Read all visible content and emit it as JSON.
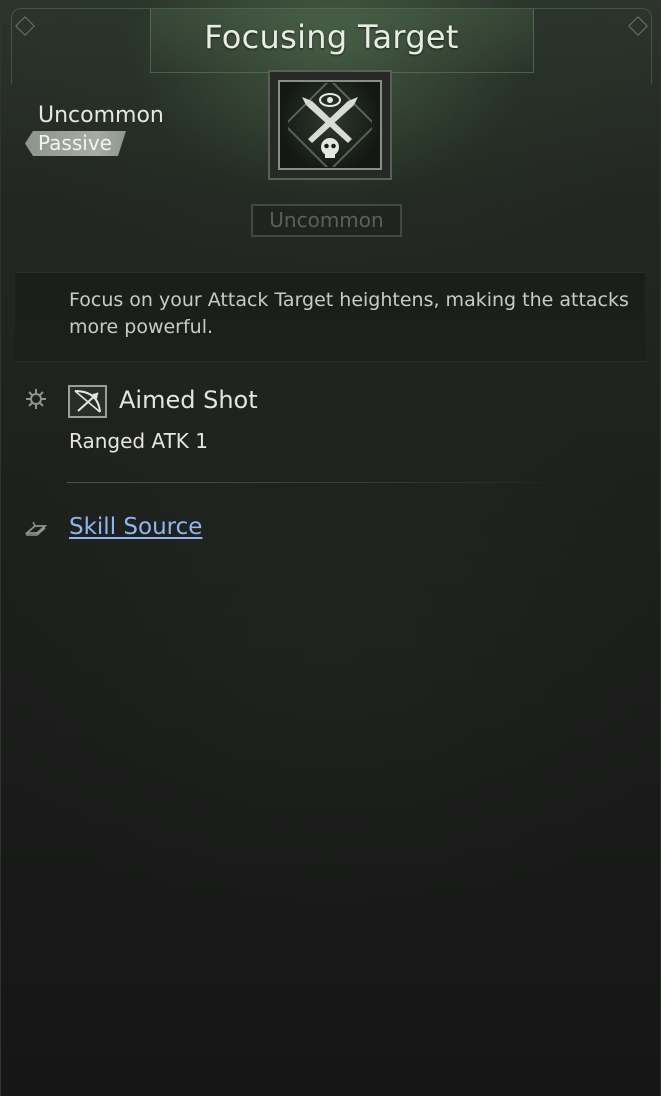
{
  "skill": {
    "title": "Focusing Target",
    "rarity": "Uncommon",
    "type": "Passive",
    "rarity_box": "Uncommon",
    "description": "Focus on your Attack Target heightens, making the attacks more powerful."
  },
  "effect": {
    "name": "Aimed Shot",
    "stat": "Ranged ATK 1"
  },
  "source": {
    "label": "Skill Source"
  },
  "colors": {
    "link": "#8fb6f0",
    "badge": "#a7ada4",
    "header_glow": "#4a6648"
  },
  "icons": {
    "skill_icon": "crossed-blades-skull-eye-icon",
    "effect_bullet": "gear-icon",
    "effect_icon": "bow-arrow-icon",
    "source_icon": "book-icon"
  }
}
